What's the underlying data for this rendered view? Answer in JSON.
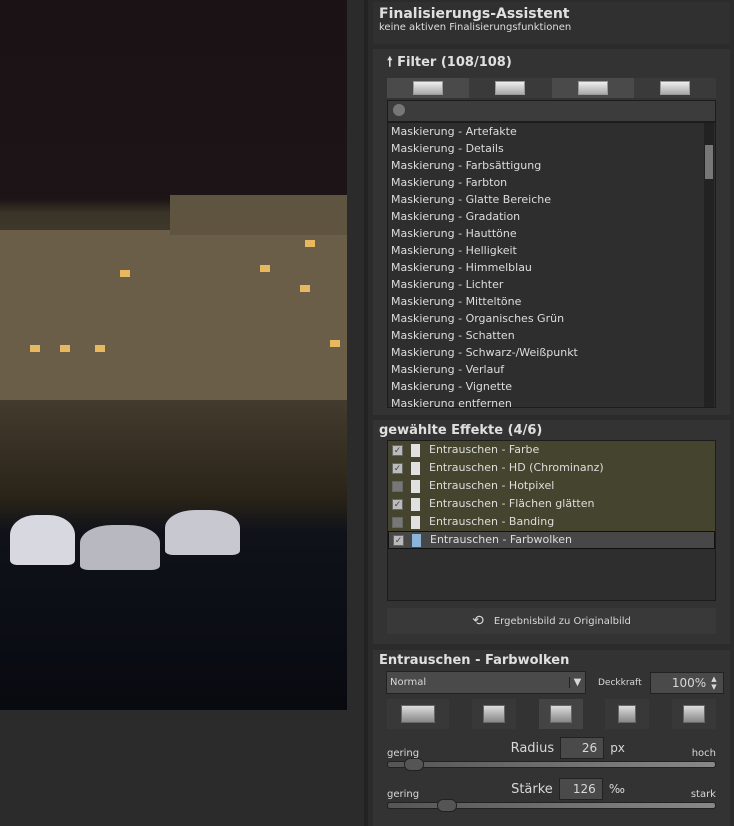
{
  "assistant": {
    "title": "Finalisierungs-Assistent",
    "subtitle": "keine aktiven Finalisierungsfunktionen"
  },
  "filter": {
    "title": "Filter (108/108)",
    "arrow_icon": "arrow-up-icon",
    "search_placeholder": "",
    "items": [
      "Maskierung - Artefakte",
      "Maskierung - Details",
      "Maskierung - Farbsättigung",
      "Maskierung - Farbton",
      "Maskierung - Glatte Bereiche",
      "Maskierung - Gradation",
      "Maskierung - Hauttöne",
      "Maskierung - Helligkeit",
      "Maskierung - Himmelblau",
      "Maskierung - Lichter",
      "Maskierung - Mitteltöne",
      "Maskierung - Organisches Grün",
      "Maskierung - Schatten",
      "Maskierung - Schwarz-/Weißpunkt",
      "Maskierung - Verlauf",
      "Maskierung - Vignette",
      "Maskierung entfernen"
    ]
  },
  "effects": {
    "title": "gewählte Effekte (4/6)",
    "items": [
      {
        "label": "Entrauschen - Farbe",
        "checked": true
      },
      {
        "label": "Entrauschen - HD (Chrominanz)",
        "checked": true
      },
      {
        "label": "Entrauschen - Hotpixel",
        "checked": false
      },
      {
        "label": "Entrauschen - Flächen glätten",
        "checked": true
      },
      {
        "label": "Entrauschen - Banding",
        "checked": false
      },
      {
        "label": "Entrauschen - Farbwolken",
        "checked": true,
        "selected": true
      }
    ],
    "reset_button": "Ergebnisbild zu Originalbild",
    "highlight_color": "#45452f"
  },
  "settings": {
    "title": "Entrauschen - Farbwolken",
    "blend_mode": "Normal",
    "opacity_label": "Deckkraft",
    "opacity": "100%",
    "radius": {
      "label": "Radius",
      "value": "26",
      "unit": "px",
      "min_label": "gering",
      "max_label": "hoch",
      "fraction": 0.05
    },
    "strength": {
      "label": "Stärke",
      "value": "126",
      "unit": "‰",
      "min_label": "gering",
      "max_label": "stark",
      "fraction": 0.15
    }
  }
}
